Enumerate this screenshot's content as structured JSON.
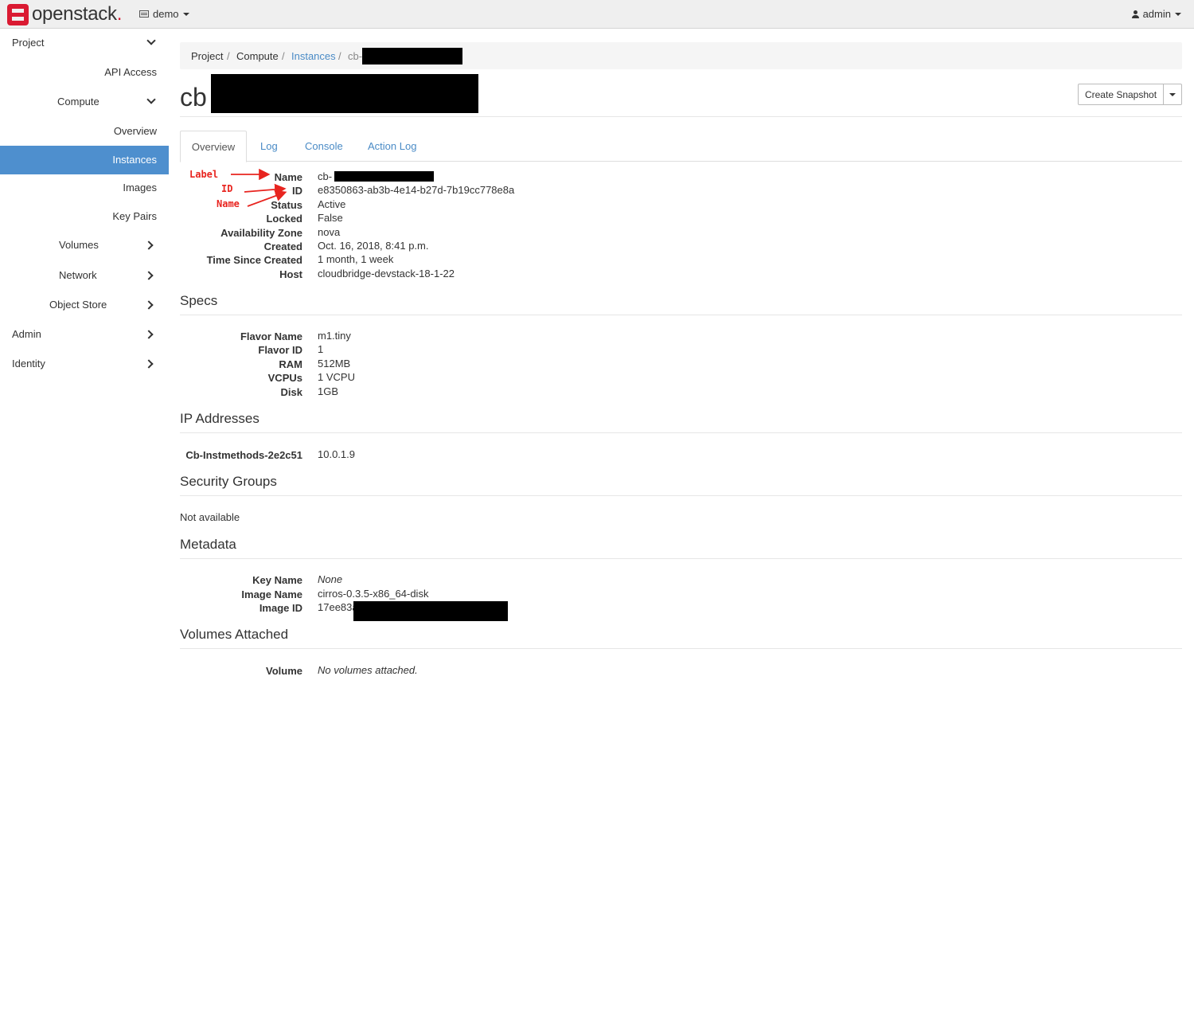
{
  "navbar": {
    "brand": "openstack",
    "brand_dot": ".",
    "project": "demo",
    "user": "admin"
  },
  "sidebar": {
    "items": [
      {
        "label": "Project",
        "icon": "chevron-down-icon"
      },
      {
        "label": "API Access"
      },
      {
        "label": "Compute",
        "icon": "chevron-down-icon"
      },
      {
        "label": "Overview"
      },
      {
        "label": "Instances",
        "active": true
      },
      {
        "label": "Images"
      },
      {
        "label": "Key Pairs"
      },
      {
        "label": "Volumes",
        "icon": "chevron-right-icon"
      },
      {
        "label": "Network",
        "icon": "chevron-right-icon"
      },
      {
        "label": "Object Store",
        "icon": "chevron-right-icon"
      },
      {
        "label": "Admin",
        "icon": "chevron-right-icon"
      },
      {
        "label": "Identity",
        "icon": "chevron-right-icon"
      }
    ]
  },
  "breadcrumb": {
    "items": [
      "Project",
      "Compute",
      "Instances",
      "cb-"
    ],
    "separator": "/"
  },
  "page": {
    "title": "cb",
    "actions": {
      "primary": "Create Snapshot"
    }
  },
  "tabs": [
    "Overview",
    "Log",
    "Console",
    "Action Log"
  ],
  "annotations": [
    "Label",
    "ID",
    "Name"
  ],
  "overview": {
    "fields": [
      {
        "label": "Name",
        "value": "cb-"
      },
      {
        "label": "ID",
        "value": "e8350863-ab3b-4e14-b27d-7b19cc778e8a"
      },
      {
        "label": "Status",
        "value": "Active"
      },
      {
        "label": "Locked",
        "value": "False"
      },
      {
        "label": "Availability Zone",
        "value": "nova"
      },
      {
        "label": "Created",
        "value": "Oct. 16, 2018, 8:41 p.m."
      },
      {
        "label": "Time Since Created",
        "value": "1 month, 1 week"
      },
      {
        "label": "Host",
        "value": "cloudbridge-devstack-18-1-22"
      }
    ]
  },
  "specs": {
    "title": "Specs",
    "fields": [
      {
        "label": "Flavor Name",
        "value": "m1.tiny"
      },
      {
        "label": "Flavor ID",
        "value": "1"
      },
      {
        "label": "RAM",
        "value": "512MB"
      },
      {
        "label": "VCPUs",
        "value": "1 VCPU"
      },
      {
        "label": "Disk",
        "value": "1GB"
      }
    ]
  },
  "ip_addresses": {
    "title": "IP Addresses",
    "fields": [
      {
        "label": "Cb-Instmethods-2e2c51",
        "value": "10.0.1.9"
      }
    ]
  },
  "security_groups": {
    "title": "Security Groups",
    "text": "Not available"
  },
  "metadata": {
    "title": "Metadata",
    "fields": [
      {
        "label": "Key Name",
        "value": "None"
      },
      {
        "label": "Image Name",
        "value": "cirros-0.3.5-x86_64-disk"
      },
      {
        "label": "Image ID",
        "value": "17ee83a"
      }
    ]
  },
  "volumes": {
    "title": "Volumes Attached",
    "fields": [
      {
        "label": "Volume",
        "value": "No volumes attached."
      }
    ]
  },
  "colors": {
    "accent": "#4e8fce",
    "link": "#4a8bc6",
    "brand_red": "#da1a32",
    "annotation_red": "#e8241f"
  }
}
